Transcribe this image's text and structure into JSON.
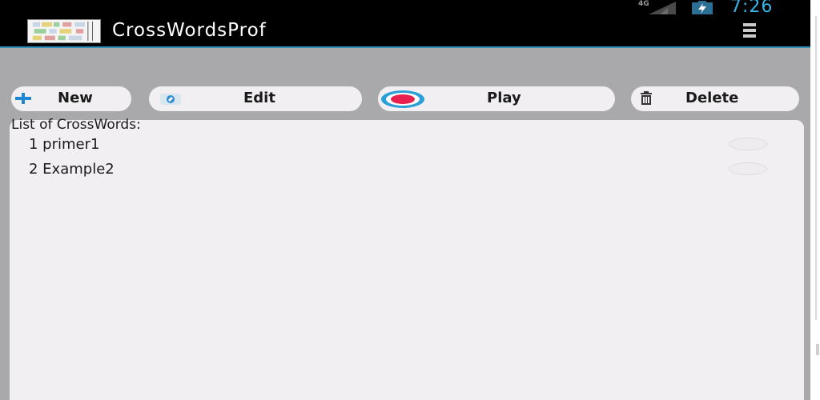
{
  "status_bar": {
    "network": "4G",
    "time": "7:26",
    "accent_color": "#33b5e5"
  },
  "action_bar": {
    "title": "CrossWordsProf",
    "app_icon": "crossword-grid-icon",
    "overflow_icon": "overflow-menu-icon"
  },
  "toolbar": {
    "new_label": "New",
    "new_icon": "plus-icon",
    "edit_label": "Edit",
    "edit_icon": "edit-icon",
    "play_label": "Play",
    "play_icon": "record-play-icon",
    "delete_label": "Delete",
    "delete_icon": "trash-icon"
  },
  "list": {
    "header": "List of CrossWords:",
    "items": [
      {
        "label": "1 primer1",
        "selected": false
      },
      {
        "label": "2 Example2",
        "selected": false
      }
    ]
  },
  "colors": {
    "background": "#a9a8aa",
    "panel": "#f1eff2",
    "plus_blue": "#1e88d6",
    "play_ring": "#2a9fd8",
    "play_dot": "#e8204e"
  }
}
